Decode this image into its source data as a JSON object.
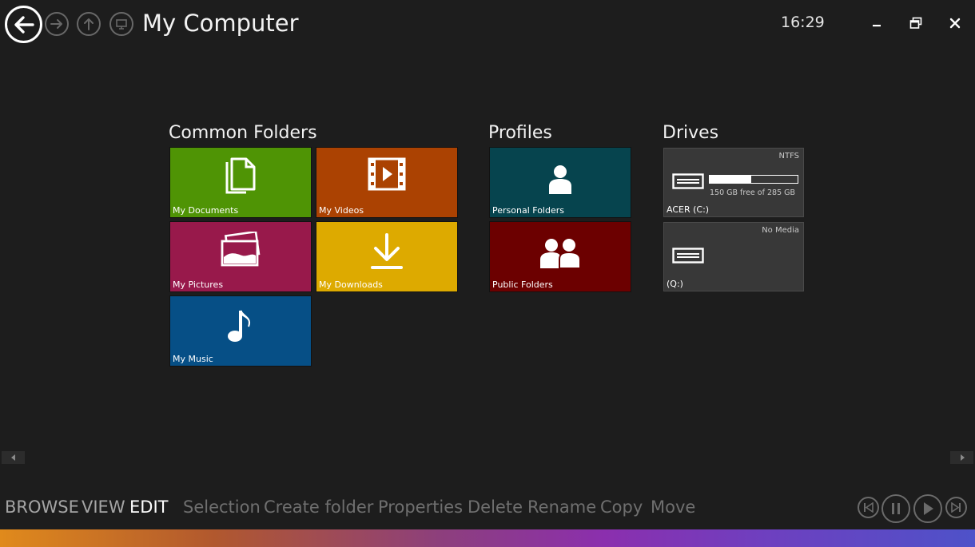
{
  "window": {
    "title": "My Computer",
    "clock": "16:29"
  },
  "nav": {
    "back_icon": "back-arrow-icon",
    "forward_icon": "forward-arrow-icon",
    "up_icon": "up-arrow-icon",
    "computer_icon": "computer-icon"
  },
  "sections": {
    "common_folders": {
      "title": "Common Folders",
      "tiles": [
        {
          "label": "My Documents",
          "color": "#4f9405",
          "icon": "documents-icon"
        },
        {
          "label": "My Videos",
          "color": "#ab4202",
          "icon": "video-icon"
        },
        {
          "label": "My Pictures",
          "color": "#98194b",
          "icon": "pictures-icon"
        },
        {
          "label": "My Downloads",
          "color": "#ddaa00",
          "icon": "download-icon"
        },
        {
          "label": "My Music",
          "color": "#064f86",
          "icon": "music-icon"
        }
      ]
    },
    "profiles": {
      "title": "Profiles",
      "tiles": [
        {
          "label": "Personal Folders",
          "color": "#06444e",
          "icon": "person-icon"
        },
        {
          "label": "Public Folders",
          "color": "#6c0000",
          "icon": "people-icon"
        }
      ]
    },
    "drives": {
      "title": "Drives",
      "items": [
        {
          "name": "ACER (C:)",
          "filesystem": "NTFS",
          "free_text": "150 GB free of 285 GB",
          "used_fraction": 0.47
        },
        {
          "name": "(Q:)",
          "filesystem": "No Media"
        }
      ]
    }
  },
  "appbar": {
    "modes": [
      "BROWSE",
      "VIEW",
      "EDIT"
    ],
    "active_mode": "EDIT",
    "commands": [
      "Selection",
      "Create folder",
      "Properties",
      "Delete",
      "Rename",
      "Copy",
      "Move"
    ],
    "media_icons": [
      "previous-track-icon",
      "pause-icon",
      "play-icon",
      "next-track-icon"
    ]
  }
}
